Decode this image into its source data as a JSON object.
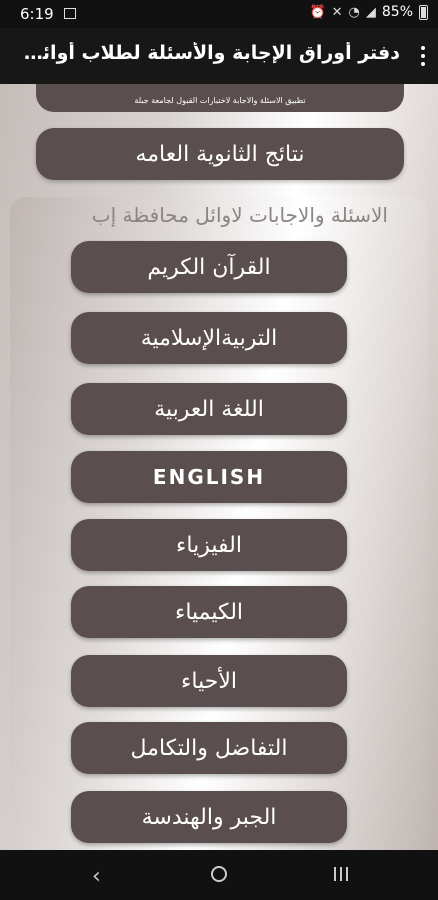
{
  "status": {
    "time": "6:19",
    "battery": "85%"
  },
  "appbar": {
    "title": "دفتر أوراق الإجابة والأسئلة لطلاب أوائل الثانوي.."
  },
  "top_card": {
    "text": "تطبيق الاسئلة والاجابة لاختبارات القبول لجامعة جبلة"
  },
  "results_button": "نتائج الثانوية العامه",
  "panel": {
    "title": "الاسئلة والاجابات لاوائل محافظة إب",
    "subjects": [
      "القرآن الكريم",
      "التربيةالإسلامية",
      "اللغة العربية",
      "ENGLISH",
      "الفيزياء",
      "الكيمياء",
      "الأحياء",
      "التفاضل والتكامل",
      "الجبر والهندسة"
    ]
  }
}
